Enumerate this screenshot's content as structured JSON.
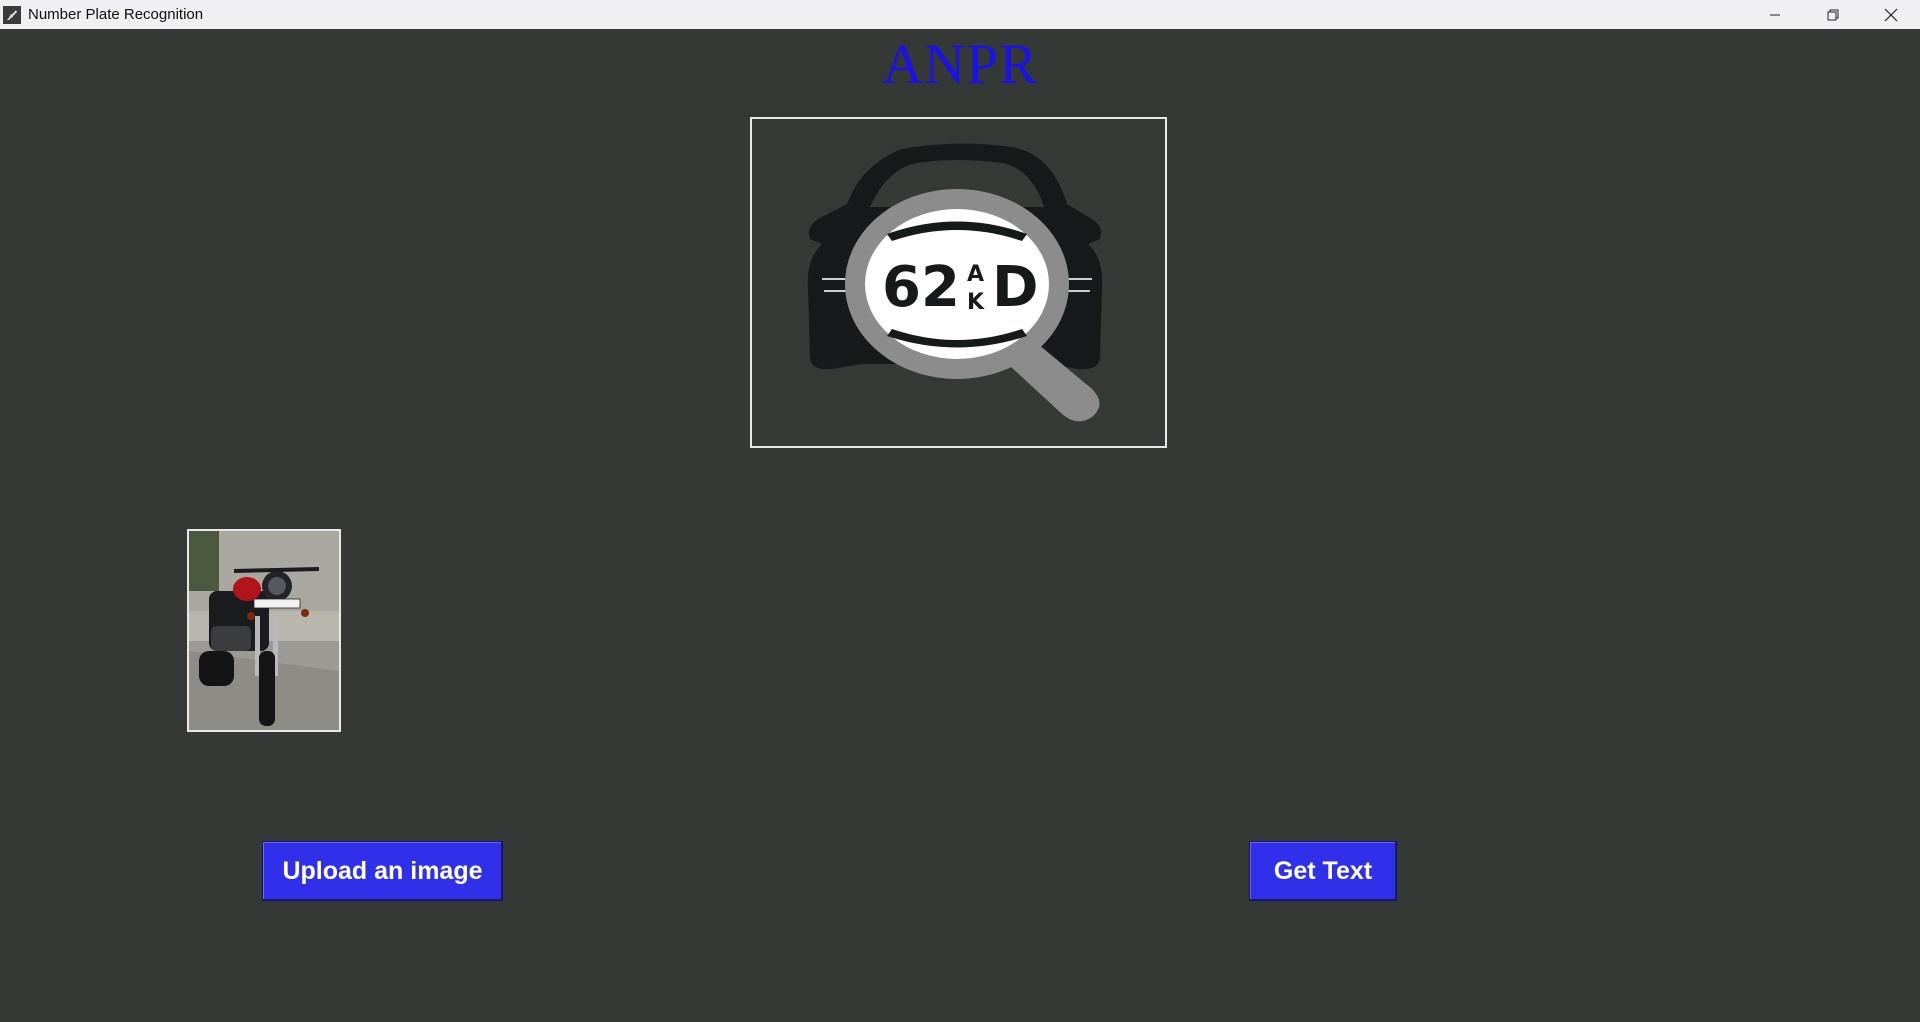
{
  "window": {
    "title": "Number Plate Recognition",
    "app_icon": "feather-app-icon",
    "controls": [
      "minimize-icon",
      "restore-icon",
      "close-icon"
    ]
  },
  "main": {
    "heading": "ANPR",
    "heading_color": "#1a12e8",
    "background_color": "#353935",
    "logo": {
      "plate_number": "62",
      "plate_letter_top": "A",
      "plate_letter_bottom": "K",
      "plate_letter_right": "D",
      "icon": "car-magnifier-icon"
    },
    "uploaded_image": {
      "icon": "motorcycle-photo"
    },
    "buttons": {
      "upload_label": "Upload an image",
      "get_text_label": "Get Text",
      "button_color": "#3030ea"
    }
  }
}
